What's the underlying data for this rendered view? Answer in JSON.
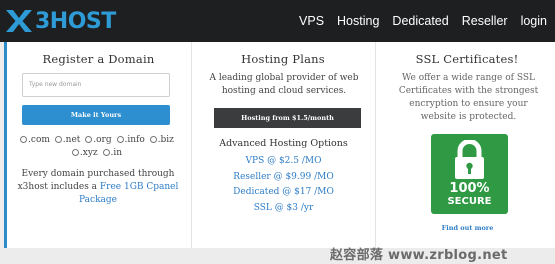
{
  "brand": {
    "logo_text": "3HOST",
    "logo_color": "#2e9bd6"
  },
  "nav": {
    "items": [
      {
        "label": "VPS"
      },
      {
        "label": "Hosting"
      },
      {
        "label": "Dedicated"
      },
      {
        "label": "Reseller"
      },
      {
        "label": "login"
      }
    ]
  },
  "domain": {
    "title": "Register a Domain",
    "input_placeholder": "Type new domain",
    "button_label": "Make it Yours",
    "tlds": [
      ".com",
      ".net",
      ".org",
      ".info",
      ".biz",
      ".xyz",
      ".in"
    ],
    "desc_prefix": "Every domain purchased through x3host includes a ",
    "desc_link": "Free 1GB Cpanel Package"
  },
  "hosting": {
    "title": "Hosting Plans",
    "desc": "A leading global provider of web hosting and cloud services.",
    "button_label": "Hosting from $1.5/month",
    "advanced_title": "Advanced Hosting Options",
    "options": [
      "VPS @ $2.5 /MO",
      "Reseller @ $9.99 /MO",
      "Dedicated @ $17 /MO",
      "SSL @ $3 /yr"
    ]
  },
  "ssl": {
    "title": "SSL Certificates!",
    "desc": "We offer a wide range of SSL Certificates with the strongest encryption to ensure your website is protected.",
    "badge_top": "100%",
    "badge_bottom": "SECURE",
    "link_label": "Find out more"
  },
  "watermark": "赵容部落 www.zrblog.net",
  "colors": {
    "header_bg": "#1d1f21",
    "accent_blue": "#2d8ed0",
    "link_blue": "#2e7dc7",
    "dark_button": "#3a3c3e",
    "seal_green": "#2f9a43"
  }
}
